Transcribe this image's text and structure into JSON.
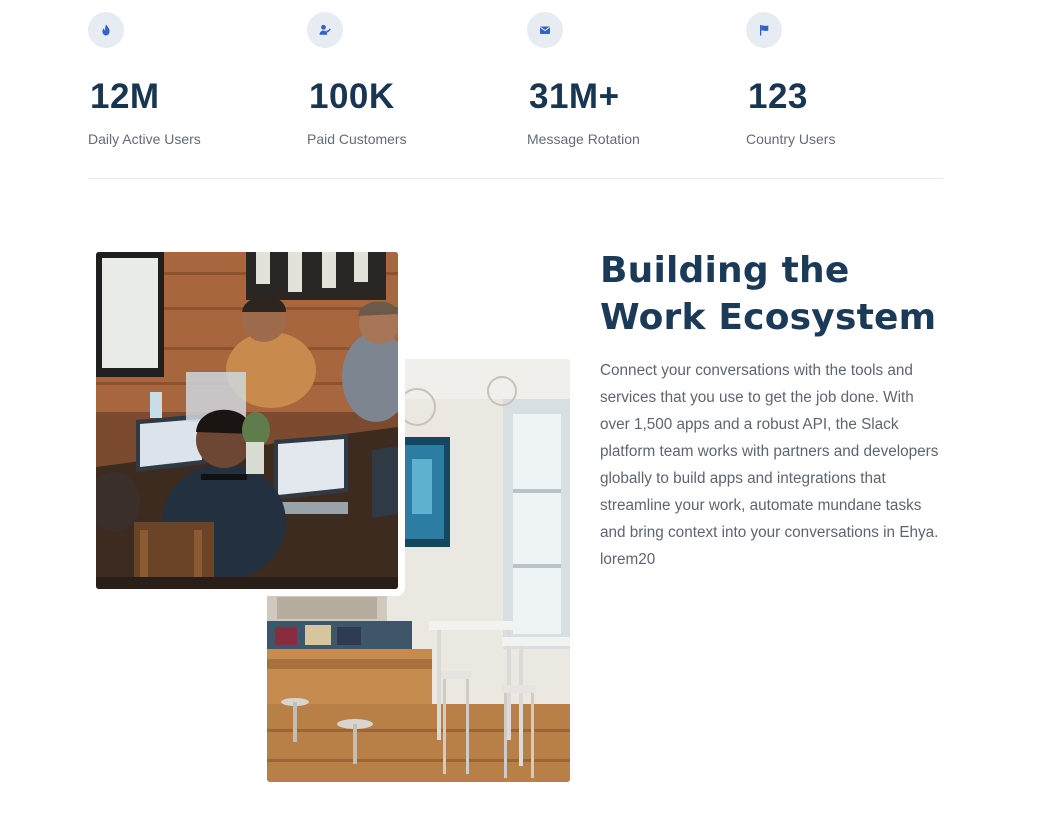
{
  "stats": [
    {
      "icon": "fire-icon",
      "value": "12M",
      "label": "Daily Active Users"
    },
    {
      "icon": "user-check-icon",
      "value": "100K",
      "label": "Paid Customers"
    },
    {
      "icon": "envelope-icon",
      "value": "31M+",
      "label": "Message Rotation"
    },
    {
      "icon": "flag-icon",
      "value": "123",
      "label": "Country Users"
    }
  ],
  "ecosystem": {
    "headline_line1": "Building the",
    "headline_line2": "Work Ecosystem",
    "body": "Connect your conversations with the tools and services that you use to get the job done. With over 1,500 apps and a robust API, the Slack platform team works with partners and developers globally to build apps and integrations that streamline your work, automate mundane tasks and bring context into your conversations in Ehya. lorem20"
  },
  "images": {
    "front": "team-meeting-photo",
    "back": "office-interior-photo"
  },
  "colors": {
    "heading": "#1b3a57",
    "icon_accent": "#2f63c9",
    "icon_bg": "#e7ebf2",
    "body_text": "#5d6570"
  }
}
